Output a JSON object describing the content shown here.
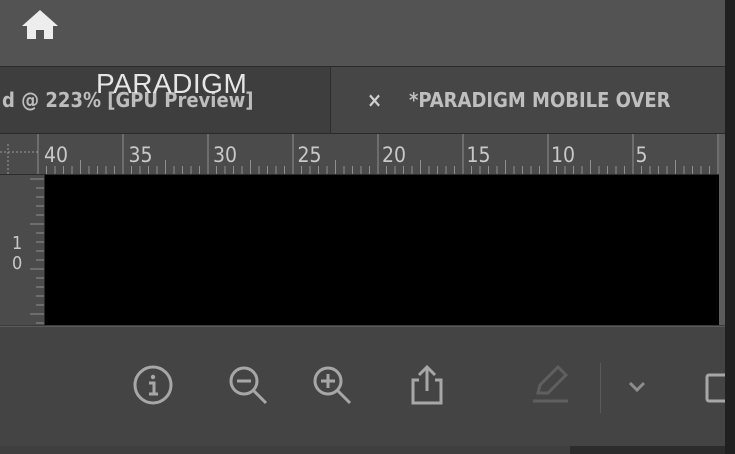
{
  "window": {
    "home_icon": "home-icon"
  },
  "tabs": [
    {
      "label": "d @ 223% [GPU Preview]",
      "overlay_label": "PARADIGM"
    },
    {
      "close_label": "×",
      "label": "*PARADIGM MOBILE OVER"
    }
  ],
  "ruler": {
    "horizontal_labels": [
      "40",
      "35",
      "30",
      "25",
      "20",
      "15",
      "10",
      "5"
    ],
    "vertical_labels": [
      "1",
      "0"
    ]
  },
  "toolbar": {
    "items": [
      "info-icon",
      "zoom-out-icon",
      "zoom-in-icon",
      "share-icon",
      "pencil-icon",
      "chevron-down-icon",
      "square-icon"
    ]
  }
}
